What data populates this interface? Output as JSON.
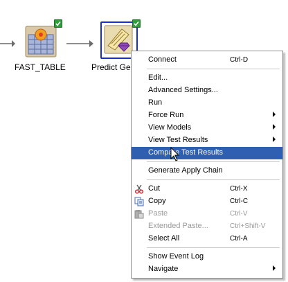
{
  "canvas": {
    "nodes": [
      {
        "name": "FAST_TABLE",
        "status": "complete"
      },
      {
        "name": "Predict Ge",
        "status": "complete"
      }
    ]
  },
  "context_menu": {
    "items": [
      {
        "label": "Connect",
        "accelerator": "Ctrl-D",
        "submenu": false,
        "enabled": true
      },
      {
        "label": "Edit...",
        "accelerator": "",
        "submenu": false,
        "enabled": true
      },
      {
        "label": "Advanced Settings...",
        "accelerator": "",
        "submenu": false,
        "enabled": true
      },
      {
        "label": "Run",
        "accelerator": "",
        "submenu": false,
        "enabled": true
      },
      {
        "label": "Force Run",
        "accelerator": "",
        "submenu": true,
        "enabled": true
      },
      {
        "label": "View Models",
        "accelerator": "",
        "submenu": true,
        "enabled": true
      },
      {
        "label": "View Test Results",
        "accelerator": "",
        "submenu": true,
        "enabled": true
      },
      {
        "label": "Compare Test Results",
        "accelerator": "",
        "submenu": false,
        "enabled": true,
        "highlighted": true
      },
      {
        "label": "Generate Apply Chain",
        "accelerator": "",
        "submenu": false,
        "enabled": true
      },
      {
        "label": "Cut",
        "accelerator": "Ctrl-X",
        "submenu": false,
        "enabled": true,
        "icon": "scissors-icon"
      },
      {
        "label": "Copy",
        "accelerator": "Ctrl-C",
        "submenu": false,
        "enabled": true,
        "icon": "copy-icon"
      },
      {
        "label": "Paste",
        "accelerator": "Ctrl-V",
        "submenu": false,
        "enabled": false,
        "icon": "paste-icon"
      },
      {
        "label": "Extended Paste...",
        "accelerator": "Ctrl+Shift-V",
        "submenu": false,
        "enabled": false
      },
      {
        "label": "Select All",
        "accelerator": "Ctrl-A",
        "submenu": false,
        "enabled": true
      },
      {
        "label": "Show Event Log",
        "accelerator": "",
        "submenu": false,
        "enabled": true
      },
      {
        "label": "Navigate",
        "accelerator": "",
        "submenu": true,
        "enabled": true
      }
    ]
  },
  "colors": {
    "highlight": "#2f5fb0",
    "selection_border": "#1a2fc8",
    "status_check": "#2f9e3a",
    "disabled_text": "#9a9a9a"
  }
}
